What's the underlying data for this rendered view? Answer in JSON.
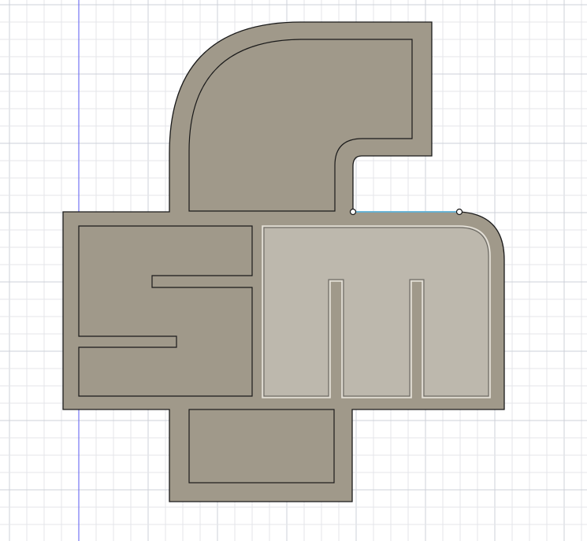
{
  "viewport": {
    "background": "#ffffff",
    "grid_minor_color": "#e4e6ea",
    "grid_major_color": "#cdd1d8",
    "axis_color": "#5a5af0"
  },
  "sketch": {
    "plate_fill": "#a0998a",
    "face_fill": "#a0998a",
    "selected_face_fill": "#bdb8ad",
    "selected_outline": "#e6e2da",
    "edge_color": "#1a1a1a",
    "selected_edge_color": "#62b6dc",
    "vertex_color": "#ffffff"
  }
}
